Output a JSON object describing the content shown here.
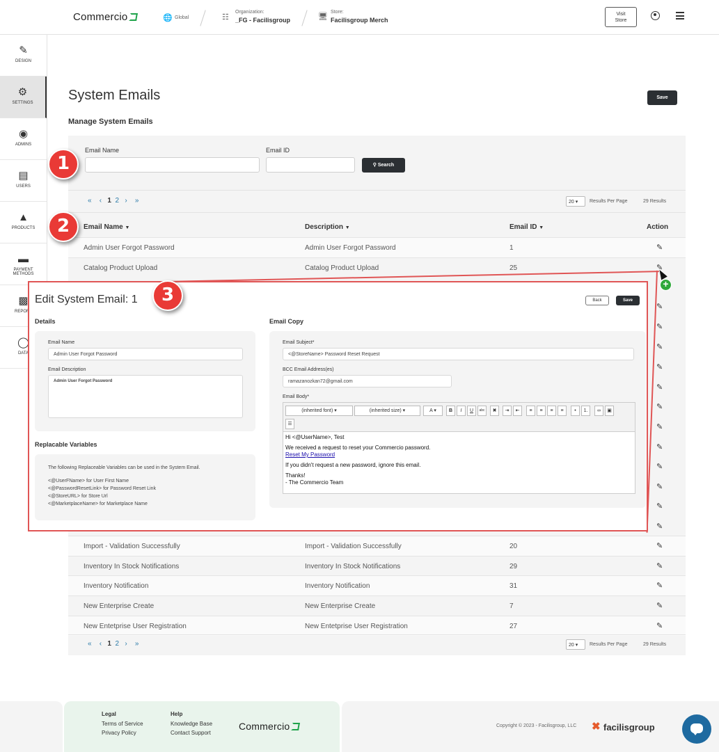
{
  "header": {
    "brand": "Commercio",
    "global_label": "Global",
    "org_label": "Organization:",
    "org_value": "_FG - Facilisgroup",
    "store_label": "Store:",
    "store_value": "Facilisgroup Merch",
    "visit_store_line1": "Visit",
    "visit_store_line2": "Store"
  },
  "sidebar": {
    "items": [
      {
        "label": "DESIGN"
      },
      {
        "label": "SETTINGS"
      },
      {
        "label": "ADMINS"
      },
      {
        "label": "USERS"
      },
      {
        "label": "PRODUCTS"
      },
      {
        "label": "PAYMENT"
      },
      {
        "label": "METHODS"
      },
      {
        "label": "REPORT"
      },
      {
        "label": "DATA"
      }
    ]
  },
  "page": {
    "title": "System Emails",
    "subtitle": "Manage System Emails",
    "save_label": "Save"
  },
  "search": {
    "email_name_label": "Email Name",
    "email_id_label": "Email ID",
    "search_label": "Search"
  },
  "pagination": {
    "pages": [
      "1",
      "2"
    ],
    "per_page": "20",
    "per_page_label": "Results Per Page",
    "results": "29 Results"
  },
  "table": {
    "headers": [
      "Email Name",
      "Description",
      "Email ID",
      "Action"
    ],
    "rows_top": [
      {
        "name": "Admin User Forgot Password",
        "desc": "Admin User Forgot Password",
        "id": "1"
      },
      {
        "name": "Catalog Product Upload",
        "desc": "Catalog Product Upload",
        "id": "25"
      }
    ],
    "rows_bottom": [
      {
        "name": "Import - Validation Successfully",
        "desc": "Import - Validation Successfully",
        "id": "20"
      },
      {
        "name": "Inventory In Stock Notifications",
        "desc": "Inventory In Stock Notifications",
        "id": "29"
      },
      {
        "name": "Inventory Notification",
        "desc": "Inventory Notification",
        "id": "31"
      },
      {
        "name": "New Enterprise Create",
        "desc": "New Enterprise Create",
        "id": "7"
      },
      {
        "name": "New Entetprise User Registration",
        "desc": "New Entetprise User Registration",
        "id": "27"
      }
    ]
  },
  "badges": [
    "1",
    "2",
    "3"
  ],
  "edit": {
    "title": "Edit System Email: 1",
    "back_label": "Back",
    "save_label": "Save",
    "details_heading": "Details",
    "email_name_label": "Email Name",
    "email_name_value": "Admin User Forgot Password",
    "email_desc_label": "Email Description",
    "email_desc_value": "Admin User Forgot Password",
    "vars_heading": "Replacable Variables",
    "vars_intro": "The following Replaceable Variables can be used in the System Email.",
    "vars": [
      "<@UserFName> for User First Name",
      "<@PasswordResetLink> for Password Reset Link",
      "<@StoreURL> for Store Url",
      "<@MarketplaceName> for Marketplace Name"
    ],
    "copy_heading": "Email Copy",
    "subject_label": "Email Subject*",
    "subject_value": "<@StoreName> Password Reset Request",
    "bcc_label": "BCC Email Address(es)",
    "bcc_value": "ramazanozkan72@gmail.com",
    "body_label": "Email Body*",
    "font_select": "(inherited font)",
    "size_select": "(inherited size)",
    "body_lines": {
      "greeting": "Hi <@UserName>, Test",
      "line1": "We received a request to reset your Commercio password.",
      "link": "Reset My Password",
      "line2": "If you didn't request a new password, ignore this email.",
      "thanks": "Thanks!",
      "sign": "- The Commercio Team"
    }
  },
  "footer": {
    "legal_heading": "Legal",
    "terms": "Terms of Service",
    "privacy": "Privacy Policy",
    "help_heading": "Help",
    "kb": "Knowledge Base",
    "support": "Contact Support",
    "brand": "Commercio",
    "copyright": "Copyright © 2023 - Facilisgroup, LLC",
    "partner": "facilisgroup"
  },
  "colors": {
    "accent_green": "#1fa34a",
    "dark_button": "#2b2f33",
    "link_blue": "#2a7aa8",
    "annotation_red": "#e93a36",
    "chat_blue": "#1e6aa0"
  }
}
